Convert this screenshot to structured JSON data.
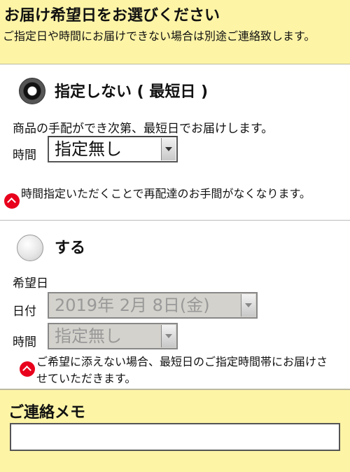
{
  "header": {
    "title": "お届け希望日をお選びください",
    "description": "ご指定日や時間にお届けできない場合は別途ご連絡致します。"
  },
  "option_unspecified": {
    "label": "指定しない ( 最短日 )",
    "selected": true,
    "description": "商品の手配ができ次第、最短日でお届けします。",
    "time_label": "時間",
    "time_value": "指定無し",
    "note": "時間指定いただくことで再配達のお手間がなくなります。"
  },
  "option_specified": {
    "label": "する",
    "selected": false,
    "desired_date_label": "希望日",
    "date_label": "日付",
    "date_value": "2019年 2月 8日(金)",
    "time_label": "時間",
    "time_value": "指定無し",
    "note": "ご希望に添えない場合、最短日のご指定時間帯にお届けさせていただきます。"
  },
  "memo": {
    "title": "ご連絡メモ",
    "value": ""
  }
}
